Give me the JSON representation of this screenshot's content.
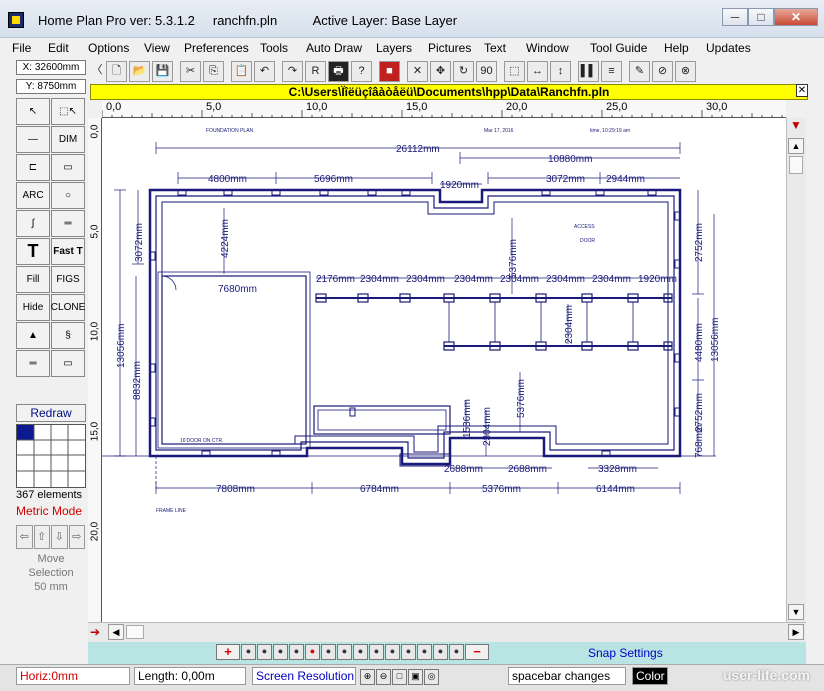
{
  "window": {
    "title": "Home Plan Pro ver: 5.3.1.2     ranchfn.pln          Active Layer: Base Layer"
  },
  "window_controls": {
    "minimize": "─",
    "maximize": "□",
    "close": "✕"
  },
  "menu": [
    "File",
    "Edit",
    "Options",
    "View",
    "Preferences",
    "Tools",
    "Auto Draw",
    "Layers",
    "Pictures",
    "Text",
    "Window",
    "Tool Guide",
    "Help",
    "Updates"
  ],
  "coords": {
    "x": "X: 32600mm",
    "y": "Y: 8750mm"
  },
  "toolbar": {
    "icons": [
      "new-document-icon",
      "open-folder-icon",
      "save-icon",
      "cut-icon",
      "copy-icon",
      "paste-icon",
      "undo-icon",
      "redo-icon",
      "print-preview-icon",
      "printer-icon",
      "help-icon",
      "color-icon",
      "delete-icon",
      "move-icon",
      "rotate-icon",
      "rotate-90-icon",
      "select-box-icon",
      "stretch-horizontal-icon",
      "stretch-vertical-icon",
      "align-icon",
      "lines-icon",
      "paint-icon",
      "undo-all-icon",
      "no-icon"
    ],
    "glyphs": [
      "🗋",
      "📂",
      "💾",
      "✂",
      "⎘",
      "📋",
      "↶",
      "↷",
      "R",
      "🖶",
      "?",
      "■",
      "✕",
      "✥",
      "↻",
      "90",
      "⬚",
      "↔",
      "↕",
      "▌▌",
      "≡",
      "✎",
      "⊘",
      "⊗"
    ]
  },
  "pathbar": {
    "text": "C:\\Users\\Ïîëüçîâàòåëü\\Documents\\hpp\\Data\\Ranchfn.pln",
    "close": "✕"
  },
  "hruler": {
    "labels": [
      "0,0",
      "5,0",
      "10,0",
      "15,0",
      "20,0",
      "25,0",
      "30,0"
    ]
  },
  "vruler": {
    "labels": [
      "0,0",
      "5,0",
      "10,0",
      "15,0",
      "20,0"
    ]
  },
  "palette": {
    "tools": [
      [
        "↖",
        "⬚↖"
      ],
      [
        "—",
        "DIM"
      ],
      [
        "⊏",
        "▭"
      ],
      [
        "ARC",
        "○"
      ],
      [
        "∫",
        "═"
      ],
      [
        "T",
        "Fast T"
      ],
      [
        "Fill",
        "FIGS"
      ],
      [
        "Hide",
        "CLONE"
      ],
      [
        "▲",
        "§"
      ],
      [
        "═",
        "▭"
      ]
    ],
    "redraw": "Redraw"
  },
  "status": {
    "elements": "367 elements",
    "mode": "Metric Mode",
    "move_label": "Move",
    "move_label2": "Selection",
    "move_amount": "50 mm"
  },
  "layer_strip": {
    "add": "+",
    "remove": "−",
    "snap": "Snap Settings"
  },
  "statusbar": {
    "horiz": "Horiz:0mm",
    "length": "Length: 0,00m",
    "resolution": "Screen Resolution",
    "spacebar": "spacebar changes",
    "color": "Color",
    "watermark": "user-life.com"
  },
  "plan": {
    "top_left_label": "FOUNDATION PLAN",
    "date_label": "Mar 17, 2016",
    "time_label": "time, 10:29:19 am",
    "access_label": "ACCESS",
    "door_label": "DOOR",
    "garage_label": "16'DOOR ON CTR.",
    "frame_label": "FRAME LINE",
    "dims": {
      "overall_top": "26112mm",
      "right_top": "10880mm",
      "d4800": "4800mm",
      "d5696": "5696mm",
      "d1920": "1920mm",
      "d3072": "3072mm",
      "d2944": "2944mm",
      "left_3072": "3072mm",
      "left_4224": "4224mm",
      "left_13056": "13056mm",
      "left_8832": "8832mm",
      "d7680": "7680mm",
      "d5376_top": "5376mm",
      "d2176": "2176mm",
      "d2304": "2304mm",
      "d1920b": "1920mm",
      "right_2752": "2752mm",
      "right_4480": "4480mm",
      "right_13056": "13056mm",
      "right_2752b": "2752mm",
      "d2304v": "2304mm",
      "d5376_mid": "5376mm",
      "d1536": "1536mm",
      "d2304_low": "2304mm",
      "d2688a": "2688mm",
      "d2688b": "2688mm",
      "d3328": "3328mm",
      "r768": "768mm",
      "b7808": "7808mm",
      "b6784": "6784mm",
      "b5376": "5376mm",
      "b6144": "6144mm"
    }
  }
}
